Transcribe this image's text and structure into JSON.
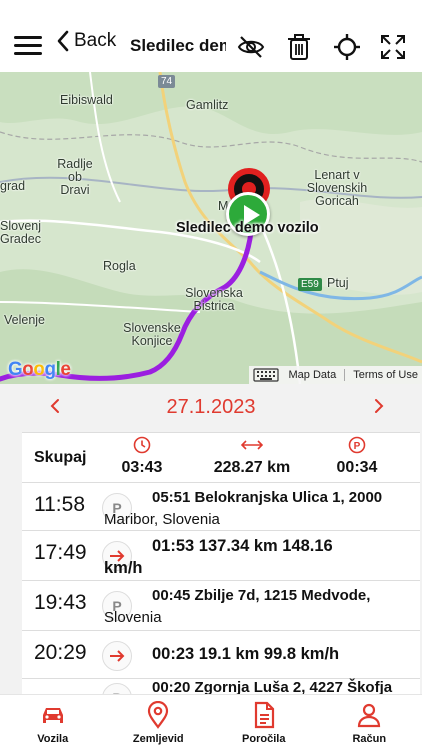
{
  "header": {
    "back_label": "Back",
    "title": "Sledilec demo vozilo"
  },
  "map": {
    "places": [
      "Gamlitz",
      "Eibiswald",
      "Radlje ob Dravi",
      "grad",
      "Slovenj Gradec",
      "Lenart v Slovenskih Goricah",
      "Rogla",
      "Ptuj",
      "Slovenska Bistrica",
      "Slovenske Konjice",
      "Velenje",
      "Maribor"
    ],
    "road_badges": [
      "74",
      "E59"
    ],
    "vehicle_label": "Sledilec demo vozilo",
    "attribution": {
      "map_data": "Map Data",
      "terms": "Terms of Use"
    },
    "colors": {
      "route": "#9b1fe0",
      "end_marker": "#e0201f",
      "start_marker": "#2daa3a"
    }
  },
  "date": {
    "prev_icon": "chevron-left",
    "value": "27.1.2023",
    "next_icon": "chevron-right"
  },
  "summary": {
    "label": "Skupaj",
    "drive_time": "03:43",
    "distance": "228.27 km",
    "park_time": "00:34"
  },
  "events": [
    {
      "time": "11:58",
      "type": "P",
      "line1": "05:51  Belokranjska Ulica 1, 2000",
      "line2": "Maribor, Slovenia"
    },
    {
      "time": "17:49",
      "type": "drive",
      "line1": "01:53  137.34 km  148.16",
      "line2": "km/h"
    },
    {
      "time": "19:43",
      "type": "P",
      "line1": "00:45  Zbilje 7d, 1215 Medvode,",
      "line2": "Slovenia"
    },
    {
      "time": "20:29",
      "type": "drive",
      "line1": "00:23  19.1 km  99.8 km/h",
      "line2": ""
    },
    {
      "time": "",
      "type": "P",
      "line1": "00:20  Zgornja Luša 2, 4227 Škofja",
      "line2": ""
    }
  ],
  "nav": [
    {
      "label": "Vozila",
      "icon": "car-icon",
      "active": true
    },
    {
      "label": "Zemljevid",
      "icon": "map-pin-icon",
      "active": false
    },
    {
      "label": "Poročila",
      "icon": "document-icon",
      "active": false
    },
    {
      "label": "Račun",
      "icon": "user-icon",
      "active": false
    }
  ],
  "accent": "#e03a2f"
}
